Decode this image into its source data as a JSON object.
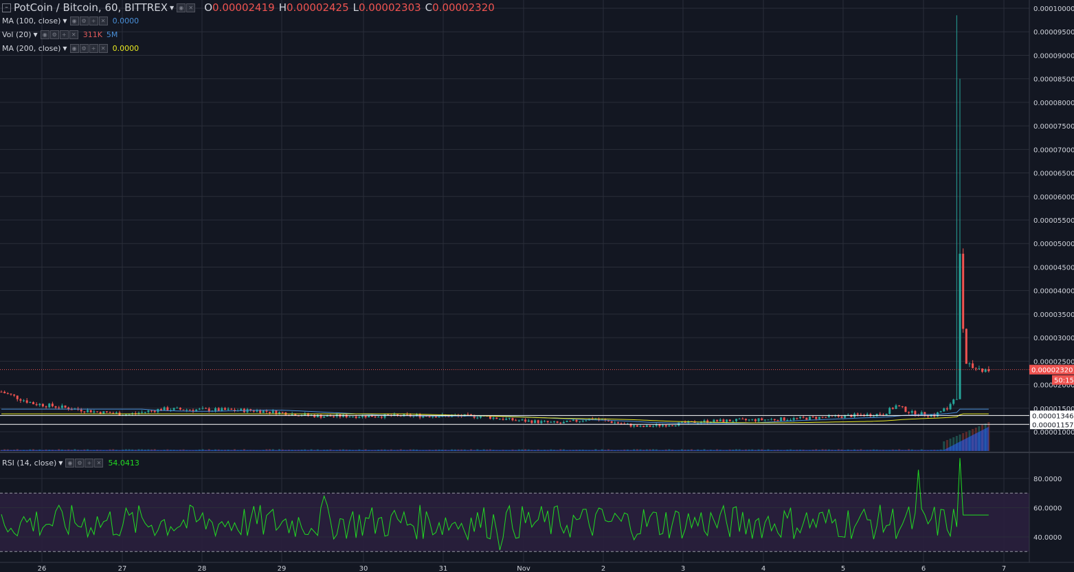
{
  "header": {
    "symbol": "PotCoin / Bitcoin, 60, BITTREX",
    "o_label": "O",
    "o_value": "0.00002419",
    "h_label": "H",
    "h_value": "0.00002425",
    "l_label": "L",
    "l_value": "0.00002303",
    "c_label": "C",
    "c_value": "0.00002320"
  },
  "indicators": {
    "ma100": {
      "label": "MA (100, close)",
      "value": "0.0000",
      "color": "#4a90d9"
    },
    "vol": {
      "label": "Vol (20)",
      "value1": "311K",
      "value2": "5M",
      "color1": "#e05a5a",
      "color2": "#4a90d9"
    },
    "ma200": {
      "label": "MA (200, close)",
      "value": "0.0000",
      "color": "#e8e821"
    },
    "rsi": {
      "label": "RSI (14, close)",
      "value": "54.0413",
      "color": "#22dd22"
    }
  },
  "price_axis": {
    "ticks": [
      "0.00010000",
      "0.00009500",
      "0.00009000",
      "0.00008500",
      "0.00008000",
      "0.00007500",
      "0.00007000",
      "0.00006500",
      "0.00006000",
      "0.00005500",
      "0.00005000",
      "0.00004500",
      "0.00004000",
      "0.00003500",
      "0.00003000",
      "0.00002500",
      "0.00002000",
      "0.00001500",
      "0.00001000"
    ],
    "current_price": "0.00002320",
    "countdown": "50:15",
    "level1": "0.00001346",
    "level2": "0.00001157"
  },
  "rsi_axis": {
    "ticks": [
      "80.0000",
      "60.0000",
      "40.0000"
    ]
  },
  "time_axis": {
    "ticks": [
      "26",
      "27",
      "28",
      "29",
      "30",
      "31",
      "Nov",
      "2",
      "3",
      "4",
      "5",
      "6",
      "7"
    ]
  },
  "colors": {
    "up": "#26a69a",
    "down": "#ef5350",
    "bg": "#131722",
    "grid": "#2a2e39",
    "rsi_band": "#2a1f3d"
  },
  "chart_data": {
    "type": "candlestick",
    "timeframe": "60",
    "symbol": "PotCoin / Bitcoin",
    "exchange": "BITTREX",
    "x_range": [
      "25",
      "7"
    ],
    "y_range": [
      1e-05,
      0.0001
    ],
    "rsi_range": [
      30,
      90
    ],
    "rsi_bands": [
      30,
      70
    ]
  }
}
